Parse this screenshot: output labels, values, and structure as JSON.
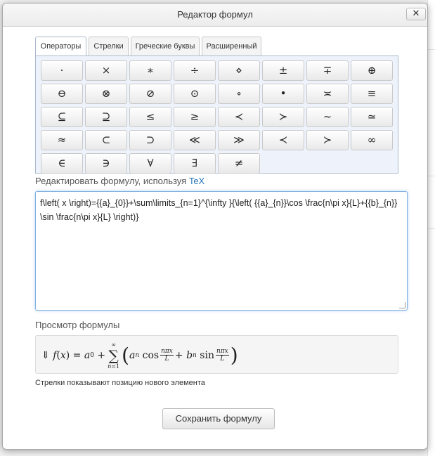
{
  "dialog": {
    "title": "Редактор формул",
    "close_label": "✕"
  },
  "tabs": [
    "Операторы",
    "Стрелки",
    "Греческие буквы",
    "Расширенный"
  ],
  "symbols": [
    [
      "·",
      "×",
      "∗",
      "÷",
      "⋄",
      "±",
      "∓",
      "⊕"
    ],
    [
      "⊖",
      "⊗",
      "⊘",
      "⊙",
      "∘",
      "•",
      "≍",
      "≡"
    ],
    [
      "⊆",
      "⊇",
      "≤",
      "≥",
      "≺",
      "≻",
      "∼",
      "≃"
    ],
    [
      "≈",
      "⊂",
      "⊃",
      "≪",
      "≫",
      "≺",
      "≻",
      "∞"
    ],
    [
      "∈",
      "∋",
      "∀",
      "∃",
      "≠"
    ]
  ],
  "editor": {
    "label": "Редактировать формулу, используя",
    "label_link": "TeX",
    "value": "f\\left( x \\right)={{a}_{0}}+\\sum\\limits_{n=1}^{\\infty }{\\left( {{a}_{n}}\\cos \\frac{n\\pi x}{L}+{{b}_{n}}\\sin \\frac{n\\pi x}{L} \\right)}"
  },
  "preview": {
    "label": "Просмотр формулы"
  },
  "hint": "Стрелки показывают позицию нового элемента",
  "save_label": "Сохранить формулу"
}
